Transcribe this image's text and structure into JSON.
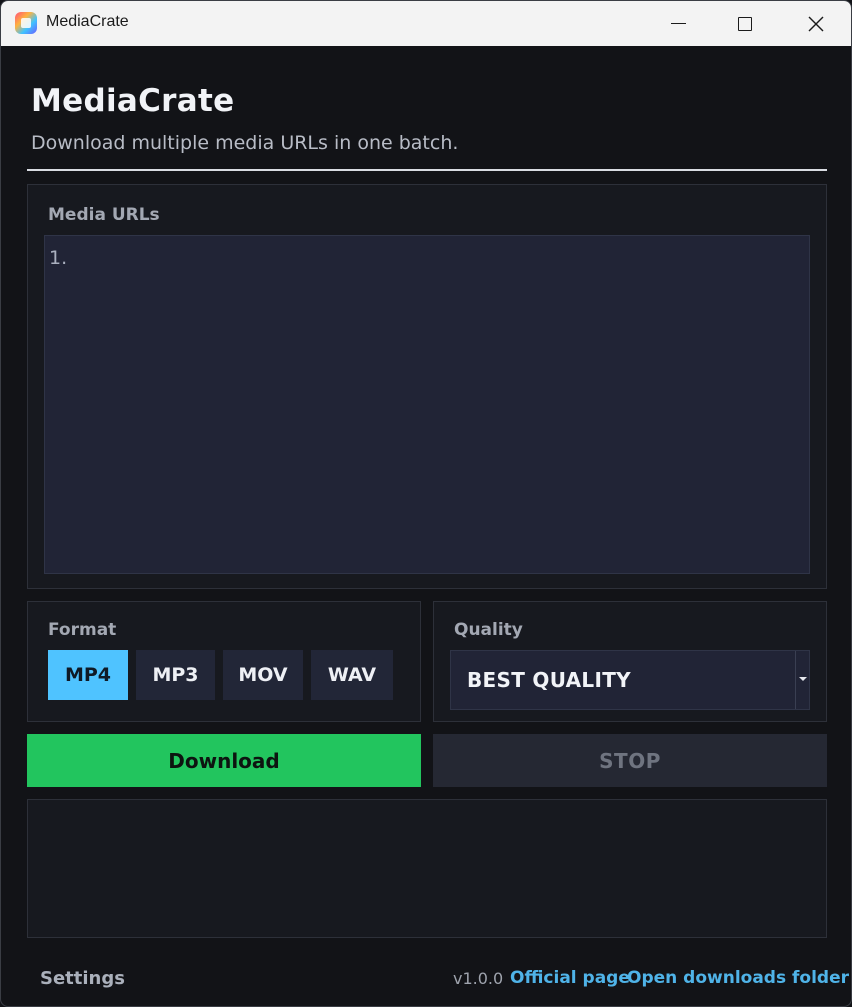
{
  "window": {
    "title": "MediaCrate"
  },
  "header": {
    "title": "MediaCrate",
    "subtitle": "Download multiple media URLs in one batch."
  },
  "urls": {
    "label": "Media URLs",
    "lines": [
      "1."
    ]
  },
  "format": {
    "label": "Format",
    "options": [
      "MP4",
      "MP3",
      "MOV",
      "WAV"
    ],
    "selected": "MP4"
  },
  "quality": {
    "label": "Quality",
    "selected": "BEST QUALITY"
  },
  "actions": {
    "download_label": "Download",
    "stop_label": "STOP"
  },
  "footer": {
    "settings_label": "Settings",
    "version": "v1.0.0",
    "official_page_label": "Official page",
    "open_folder_label": "Open downloads folder"
  },
  "colors": {
    "background": "#121317",
    "accent": "#4fc3ff",
    "download": "#22c55e",
    "link": "#4fb3e8"
  }
}
